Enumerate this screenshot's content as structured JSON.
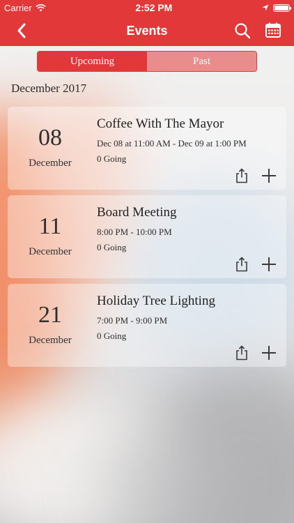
{
  "status_bar": {
    "carrier": "Carrier",
    "time": "2:52 PM",
    "battery_level": 1.0
  },
  "nav": {
    "title": "Events",
    "back_icon": "chevron-left-icon",
    "search_icon": "search-icon",
    "calendar_icon": "calendar-icon"
  },
  "segments": {
    "upcoming": "Upcoming",
    "past": "Past",
    "selected": "upcoming"
  },
  "month_header": "December 2017",
  "events": [
    {
      "day": "08",
      "month": "December",
      "title": "Coffee With The Mayor",
      "time": "Dec 08 at 11:00 AM - Dec 09 at 1:00 PM",
      "going": "0 Going"
    },
    {
      "day": "11",
      "month": "December",
      "title": "Board Meeting",
      "time": "8:00 PM - 10:00 PM",
      "going": "0 Going"
    },
    {
      "day": "21",
      "month": "December",
      "title": "Holiday Tree Lighting",
      "time": "7:00 PM - 9:00 PM",
      "going": "0 Going"
    }
  ],
  "colors": {
    "brand_red": "#e3383a",
    "segment_inactive": "#ec8486"
  }
}
